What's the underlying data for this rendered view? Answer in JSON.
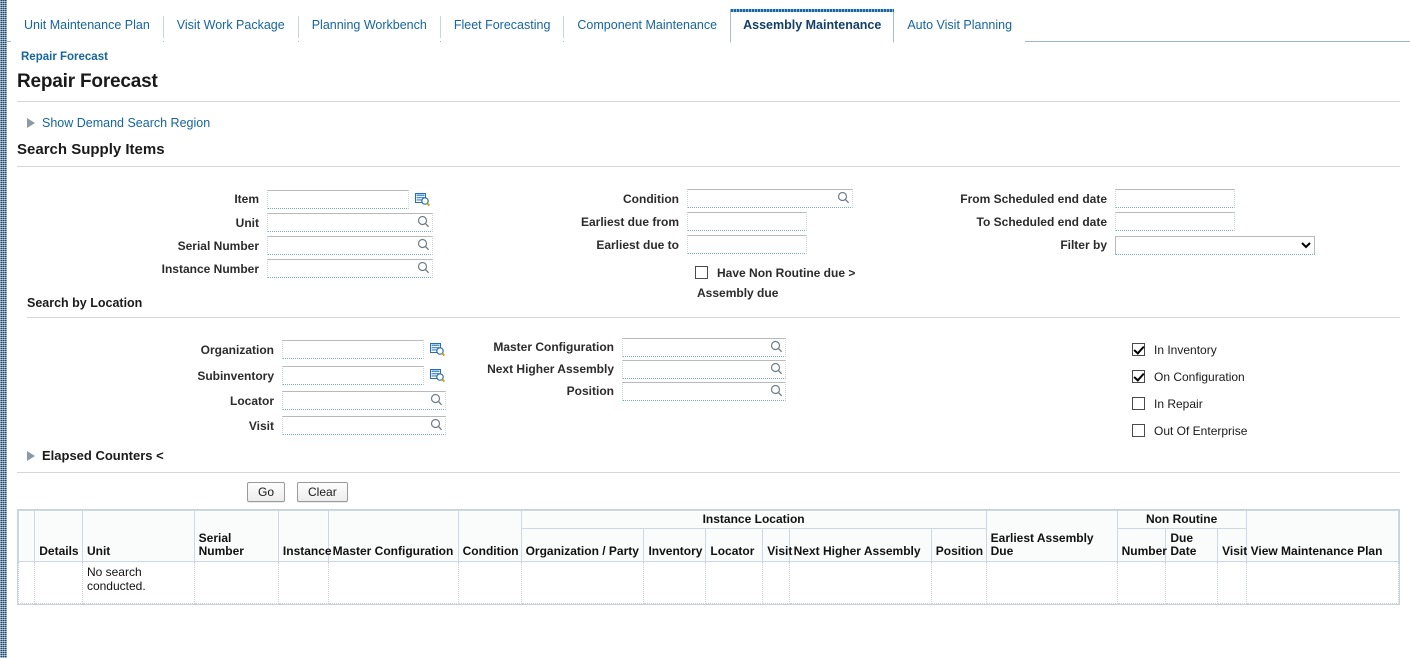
{
  "tabs": [
    {
      "label": "Unit Maintenance Plan",
      "active": false
    },
    {
      "label": "Visit Work Package",
      "active": false
    },
    {
      "label": "Planning Workbench",
      "active": false
    },
    {
      "label": "Fleet Forecasting",
      "active": false
    },
    {
      "label": "Component Maintenance",
      "active": false
    },
    {
      "label": "Assembly Maintenance",
      "active": true
    },
    {
      "label": "Auto Visit Planning",
      "active": false
    }
  ],
  "breadcrumb": "Repair Forecast",
  "page_title": "Repair Forecast",
  "disclosure": {
    "demand_search": "Show Demand Search Region",
    "elapsed_counters": "Elapsed Counters <"
  },
  "sections": {
    "search_supply_items": "Search Supply Items",
    "search_by_location": "Search by Location"
  },
  "supply_fields": {
    "item": {
      "label": "Item",
      "value": "",
      "placeholder": ""
    },
    "unit": {
      "label": "Unit",
      "value": "",
      "placeholder": ""
    },
    "serial_number": {
      "label": "Serial Number",
      "value": "",
      "placeholder": ""
    },
    "instance_number": {
      "label": "Instance Number",
      "value": "",
      "placeholder": ""
    },
    "condition": {
      "label": "Condition",
      "value": "",
      "placeholder": ""
    },
    "earliest_due_from": {
      "label": "Earliest due from",
      "value": "",
      "placeholder": ""
    },
    "earliest_due_to": {
      "label": "Earliest due to",
      "value": "",
      "placeholder": ""
    },
    "non_routine_checkbox": {
      "label_line1": "Have Non Routine due >",
      "label_line2": "Assembly due",
      "checked": false
    },
    "from_scheduled_end_date": {
      "label": "From Scheduled end date",
      "value": "",
      "placeholder": ""
    },
    "to_scheduled_end_date": {
      "label": "To Scheduled end date",
      "value": "",
      "placeholder": ""
    },
    "filter_by": {
      "label": "Filter by",
      "value": "",
      "options": [
        ""
      ]
    }
  },
  "location_fields": {
    "organization": {
      "label": "Organization",
      "value": "",
      "placeholder": ""
    },
    "subinventory": {
      "label": "Subinventory",
      "value": "",
      "placeholder": ""
    },
    "locator": {
      "label": "Locator",
      "value": "",
      "placeholder": ""
    },
    "visit": {
      "label": "Visit",
      "value": "",
      "placeholder": ""
    },
    "master_configuration": {
      "label": "Master Configuration",
      "value": "",
      "placeholder": ""
    },
    "next_higher_assembly": {
      "label": "Next Higher Assembly",
      "value": "",
      "placeholder": ""
    },
    "position": {
      "label": "Position",
      "value": "",
      "placeholder": ""
    }
  },
  "location_checkboxes": [
    {
      "label": "In Inventory",
      "checked": true
    },
    {
      "label": "On Configuration",
      "checked": true
    },
    {
      "label": "In Repair",
      "checked": false
    },
    {
      "label": "Out Of Enterprise",
      "checked": false
    }
  ],
  "buttons": {
    "go": "Go",
    "clear": "Clear"
  },
  "results_table": {
    "group_headers": {
      "instance_location": "Instance Location",
      "non_routine": "Non Routine"
    },
    "columns": {
      "details": "Details",
      "unit": "Unit",
      "serial_number": "Serial Number",
      "instance": "Instance",
      "master_configuration": "Master Configuration",
      "condition": "Condition",
      "organization_party": "Organization / Party",
      "inventory": "Inventory",
      "locator": "Locator",
      "visit": "Visit",
      "next_higher_assembly": "Next Higher Assembly",
      "position": "Position",
      "earliest_assembly_due": "Earliest Assembly Due",
      "nr_number": "Number",
      "nr_due_date": "Due Date",
      "nr_visit": "Visit",
      "view_maintenance_plan": "View Maintenance Plan"
    },
    "rows": [
      {
        "details": "",
        "unit": "No search conducted.",
        "serial_number": "",
        "instance": "",
        "master_configuration": "",
        "condition": "",
        "organization_party": "",
        "inventory": "",
        "locator": "",
        "visit": "",
        "next_higher_assembly": "",
        "position": "",
        "earliest_assembly_due": "",
        "nr_number": "",
        "nr_due_date": "",
        "nr_visit": "",
        "view_maintenance_plan": ""
      }
    ]
  },
  "colors": {
    "link": "#15659f",
    "active_tab_border": "#1669a8",
    "rail": "#1a4971",
    "header_bg": "#f2f5f8"
  }
}
